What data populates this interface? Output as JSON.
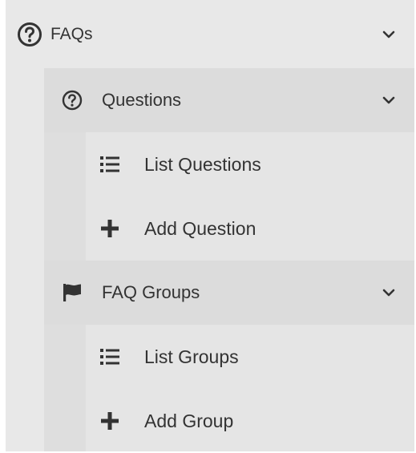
{
  "menu": {
    "faqs": {
      "label": "FAQs",
      "icon": "question-circle-icon"
    },
    "questions": {
      "label": "Questions",
      "icon": "question-circle-icon",
      "items": [
        {
          "label": "List Questions",
          "icon": "list-icon"
        },
        {
          "label": "Add Question",
          "icon": "plus-icon"
        }
      ]
    },
    "groups": {
      "label": "FAQ Groups",
      "icon": "flag-icon",
      "items": [
        {
          "label": "List Groups",
          "icon": "list-icon"
        },
        {
          "label": "Add Group",
          "icon": "plus-icon"
        }
      ]
    }
  },
  "colors": {
    "text": "#333333",
    "level1_bg": "#e8e8e8",
    "level2_bg": "#dcdcdc",
    "level3_bg": "#e5e5e5"
  }
}
